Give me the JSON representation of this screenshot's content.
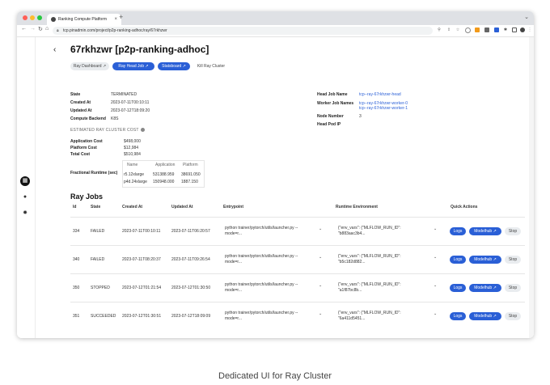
{
  "colors": {
    "accent": "#2a5fd6",
    "close": "#ff5f57",
    "minimize": "#febc2e",
    "maximize": "#28c840"
  },
  "browser": {
    "tab_title": "Ranking Compute Platform",
    "tab_close": "×",
    "new_tab": "+",
    "tab_menu": "⌄",
    "url": "tcp.pinadmin.com/project/p2p-ranking-adhoc/ray/67rkhzwr"
  },
  "page": {
    "back": "‹",
    "title": "67rkhzwr [p2p-ranking-adhoc]",
    "tabs": {
      "ray_dashboard": "Ray Dashboard ↗",
      "ray_head_job": "Ray Head Job ↗",
      "statsboard": "Statsboard ↗",
      "kill_ray_cluster": "Kill Ray Cluster"
    }
  },
  "details": {
    "state_label": "State",
    "state_value": "TERMINATED",
    "created_label": "Created At",
    "created_value": "2023-07-11T00:10:11",
    "updated_label": "Updated At",
    "updated_value": "2023-07-12T18:09:20",
    "backend_label": "Compute Backend",
    "backend_value": "K8S",
    "head_job_label": "Head Job Name",
    "head_job_value": "tcp--ray-67rkhzwr-head",
    "worker_label": "Worker Job Names",
    "worker_1": "tcp--ray-67rkhzwr-worker-0",
    "worker_2": "tcp--ray-67rkhzwr-worker-1",
    "node_label": "Node Number",
    "node_value": "3",
    "head_ip_label": "Head Pod IP",
    "head_ip_value": ""
  },
  "cost": {
    "section_title": "ESTIMATED RAY CLUSTER COST",
    "app_label": "Application Cost",
    "app_value": "$498,000",
    "platform_label": "Platform Cost",
    "platform_value": "$12,984",
    "total_label": "Total Cost",
    "total_value": "$510,984",
    "fractional_label": "Fractional Runtime (sec)",
    "columns": [
      "Name",
      "Application",
      "Platform"
    ],
    "rows": [
      [
        "r5.12xlarge",
        "531388.959",
        "38691.050"
      ],
      [
        "p4d.24xlarge",
        "150948.000",
        "1887.150"
      ]
    ]
  },
  "jobs": {
    "heading": "Ray Jobs",
    "columns": {
      "id": "Id",
      "state": "State",
      "created": "Created At",
      "updated": "Updated At",
      "entrypoint": "Entrypoint",
      "runtime": "Runtime Environment",
      "actions": "Quick Actions"
    },
    "actions": {
      "logs": "Logs",
      "modelhub": "Modelhub ↗",
      "stop": "Stop"
    },
    "chevron": "⌄",
    "rows": [
      {
        "id": "334",
        "state": "FAILED",
        "created": "2023-07-11T00:10:11",
        "updated": "2023-07-11T06:20:57",
        "entry_1": "python trainer/pytorch/utils/launcher.py --",
        "entry_2": "mode=r...",
        "runtime_1": "{\"env_vars\": {\"MLFLOW_RUN_ID\":",
        "runtime_2": "\"b883aac3b4..."
      },
      {
        "id": "340",
        "state": "FAILED",
        "created": "2023-07-11T08:20:37",
        "updated": "2023-07-11T09:26:54",
        "entry_1": "python trainer/pytorch/utils/launcher.py --",
        "entry_2": "mode=r...",
        "runtime_1": "{\"env_vars\": {\"MLFLOW_RUN_ID\":",
        "runtime_2": "\"b5c182d882..."
      },
      {
        "id": "350",
        "state": "STOPPED",
        "created": "2023-07-12T01:21:54",
        "updated": "2023-07-12T01:30:50",
        "entry_1": "python trainer/pytorch/utils/launcher.py --",
        "entry_2": "mode=r...",
        "runtime_1": "{\"env_vars\": {\"MLFLOW_RUN_ID\":",
        "runtime_2": "\"a1f87bc8b..."
      },
      {
        "id": "351",
        "state": "SUCCEEDED",
        "created": "2023-07-12T01:30:51",
        "updated": "2023-07-12T18:09:09",
        "entry_1": "python trainer/pytorch/utils/launcher.py --",
        "entry_2": "mode=r...",
        "runtime_1": "{\"env_vars\": {\"MLFLOW_RUN_ID\":",
        "runtime_2": "\"6a411d5451..."
      }
    ]
  },
  "caption": "Dedicated UI for Ray Cluster"
}
